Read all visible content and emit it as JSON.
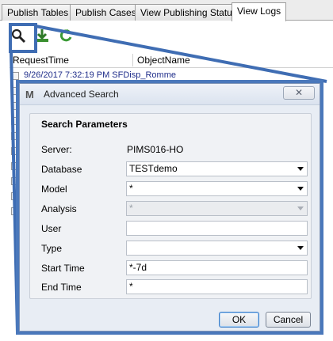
{
  "tabs": [
    {
      "label": "Publish Tables",
      "active": false
    },
    {
      "label": "Publish Cases",
      "active": false
    },
    {
      "label": "View Publishing Status",
      "active": false
    },
    {
      "label": "View Logs",
      "active": true
    }
  ],
  "toolbar": {
    "icons": [
      "search-icon",
      "download-icon",
      "refresh-icon"
    ]
  },
  "grid": {
    "columns": [
      "RequestTime",
      "ObjectName"
    ],
    "partial_row_text": "9/26/2017 7:32:19 PM   SFDisp_Romme"
  },
  "dialog": {
    "title": "Advanced Search",
    "icon_glyph": "M",
    "close_glyph": "✕",
    "group_title": "Search Parameters",
    "fields": {
      "server": {
        "label": "Server:",
        "value": "PIMS016-HO"
      },
      "database": {
        "label": "Database",
        "value": "TESTdemo"
      },
      "model": {
        "label": "Model",
        "value": "*"
      },
      "analysis": {
        "label": "Analysis",
        "value": "*"
      },
      "user": {
        "label": "User",
        "value": ""
      },
      "type": {
        "label": "Type",
        "value": ""
      },
      "start_time": {
        "label": "Start Time",
        "value": "*-7d"
      },
      "end_time": {
        "label": "End Time",
        "value": "*"
      }
    },
    "ok_label": "OK",
    "cancel_label": "Cancel"
  },
  "colors": {
    "callout_blue": "#3f6db3",
    "dialog_border": "#4a78bb",
    "tab_border": "#9c9c9c"
  }
}
